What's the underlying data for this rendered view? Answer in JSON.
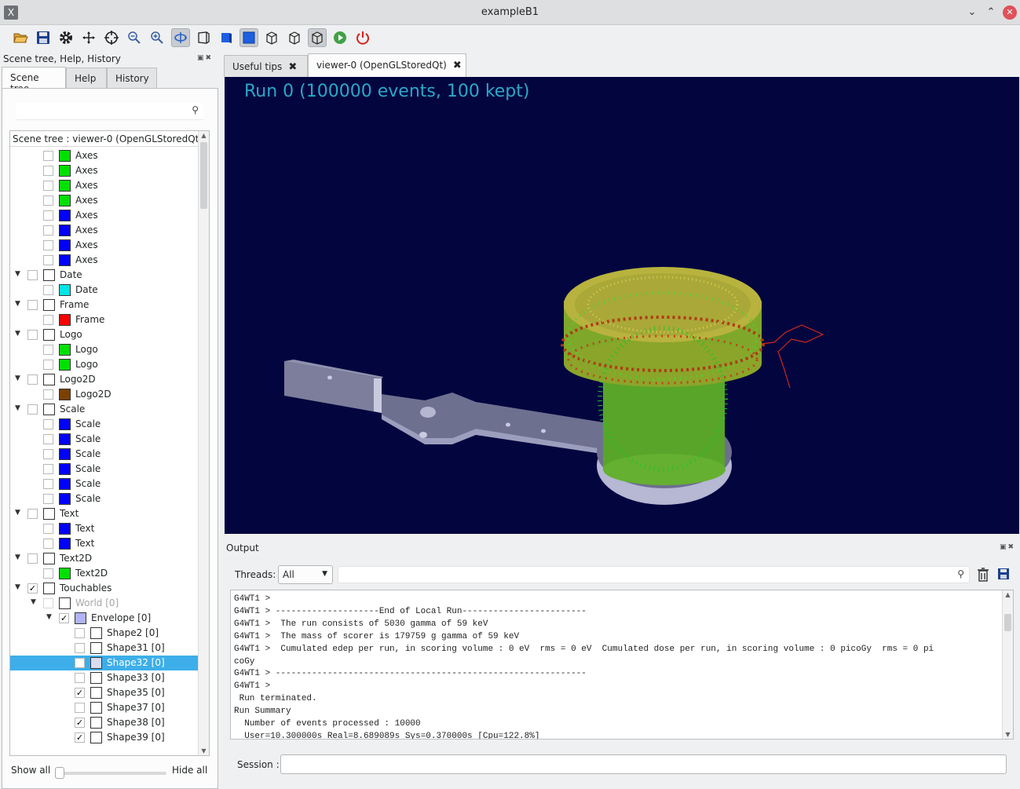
{
  "window": {
    "title": "exampleB1",
    "app_icon": "X"
  },
  "toolbar": {
    "icons": [
      "open-icon",
      "save-icon",
      "gear-icon",
      "move-icon",
      "pick-icon",
      "zoom-out-icon",
      "zoom-in-icon",
      "rotate-icon",
      "perspective-icon",
      "ortho-icon",
      "surface-icon",
      "wireframe-icon",
      "hidden-line-icon",
      "hidden-surface-icon",
      "run-beam-icon",
      "exit-icon"
    ]
  },
  "left_panel": {
    "title": "Scene tree, Help, History",
    "tabs": [
      "Scene tree",
      "Help",
      "History"
    ],
    "active_tab": "Scene tree",
    "search_placeholder": "",
    "tree_header": "Scene tree : viewer-0 (OpenGLStoredQt)",
    "rows": [
      {
        "label": "Axes",
        "color": "#00e000",
        "indent": 2
      },
      {
        "label": "Axes",
        "color": "#00e000",
        "indent": 2
      },
      {
        "label": "Axes",
        "color": "#00e000",
        "indent": 2
      },
      {
        "label": "Axes",
        "color": "#00e000",
        "indent": 2
      },
      {
        "label": "Axes",
        "color": "#0000ff",
        "indent": 2
      },
      {
        "label": "Axes",
        "color": "#0000ff",
        "indent": 2
      },
      {
        "label": "Axes",
        "color": "#0000ff",
        "indent": 2
      },
      {
        "label": "Axes",
        "color": "#0000ff",
        "indent": 2
      },
      {
        "label": "Date",
        "color": "#ffffff",
        "indent": 1,
        "arrow": true
      },
      {
        "label": "Date",
        "color": "#00e5e5",
        "indent": 2
      },
      {
        "label": "Frame",
        "color": "#ffffff",
        "indent": 1,
        "arrow": true
      },
      {
        "label": "Frame",
        "color": "#ff0000",
        "indent": 2
      },
      {
        "label": "Logo",
        "color": "#ffffff",
        "indent": 1,
        "arrow": true
      },
      {
        "label": "Logo",
        "color": "#00e000",
        "indent": 2
      },
      {
        "label": "Logo",
        "color": "#00e000",
        "indent": 2
      },
      {
        "label": "Logo2D",
        "color": "#ffffff",
        "indent": 1,
        "arrow": true
      },
      {
        "label": "Logo2D",
        "color": "#7a4000",
        "indent": 2
      },
      {
        "label": "Scale",
        "color": "#ffffff",
        "indent": 1,
        "arrow": true
      },
      {
        "label": "Scale",
        "color": "#0000ff",
        "indent": 2
      },
      {
        "label": "Scale",
        "color": "#0000ff",
        "indent": 2
      },
      {
        "label": "Scale",
        "color": "#0000ff",
        "indent": 2
      },
      {
        "label": "Scale",
        "color": "#0000ff",
        "indent": 2
      },
      {
        "label": "Scale",
        "color": "#0000ff",
        "indent": 2
      },
      {
        "label": "Scale",
        "color": "#0000ff",
        "indent": 2
      },
      {
        "label": "Text",
        "color": "#ffffff",
        "indent": 1,
        "arrow": true
      },
      {
        "label": "Text",
        "color": "#0000ff",
        "indent": 2
      },
      {
        "label": "Text",
        "color": "#0000ff",
        "indent": 2
      },
      {
        "label": "Text2D",
        "color": "#ffffff",
        "indent": 1,
        "arrow": true
      },
      {
        "label": "Text2D",
        "color": "#00e000",
        "indent": 2
      },
      {
        "label": "Touchables",
        "color": "#ffffff",
        "indent": 1,
        "arrow": true,
        "checked": true
      },
      {
        "label": "World [0]",
        "color": "#ffffff",
        "indent": 2,
        "arrow": true,
        "disabled": true
      },
      {
        "label": "Envelope [0]",
        "color": "#b0b4f8",
        "indent": 3,
        "arrow": true,
        "checked": true
      },
      {
        "label": "Shape2 [0]",
        "color": "#ffffff",
        "indent": 4
      },
      {
        "label": "Shape31 [0]",
        "color": "#ffffff",
        "indent": 4
      },
      {
        "label": "Shape32 [0]",
        "color": "#dcdcf0",
        "indent": 4,
        "selected": true
      },
      {
        "label": "Shape33 [0]",
        "color": "#ffffff",
        "indent": 4
      },
      {
        "label": "Shape35 [0]",
        "color": "#ffffff",
        "indent": 4,
        "checked": true
      },
      {
        "label": "Shape37 [0]",
        "color": "#ffffff",
        "indent": 4
      },
      {
        "label": "Shape38 [0]",
        "color": "#ffffff",
        "indent": 4,
        "checked": true
      },
      {
        "label": "Shape39 [0]",
        "color": "#ffffff",
        "indent": 4,
        "checked": true
      }
    ],
    "show_all": "Show all",
    "hide_all": "Hide all"
  },
  "viewer_tabs": [
    {
      "label": "Useful tips",
      "active": false
    },
    {
      "label": "viewer-0 (OpenGLStoredQt)",
      "active": true
    }
  ],
  "viewer": {
    "run_label": "Run 0 (100000 events, 100 kept)",
    "background": "#03053f"
  },
  "output": {
    "title": "Output",
    "threads_label": "Threads:",
    "threads_value": "All",
    "filter_placeholder": "",
    "lines": [
      "G4WT1 >",
      "G4WT1 > --------------------End of Local Run------------------------",
      "G4WT1 >  The run consists of 5030 gamma of 59 keV",
      "G4WT1 >  The mass of scorer is 179759 g gamma of 59 keV",
      "G4WT1 >  Cumulated edep per run, in scoring volume : 0 eV  rms = 0 eV  Cumulated dose per run, in scoring volume : 0 picoGy  rms = 0 pi",
      "coGy",
      "G4WT1 > ------------------------------------------------------------",
      "G4WT1 >",
      " Run terminated.",
      "Run Summary",
      "  Number of events processed : 10000",
      "  User=10.300000s Real=8.689089s Sys=0.370000s [Cpu=122.8%]"
    ],
    "session_label": "Session :",
    "session_value": ""
  }
}
